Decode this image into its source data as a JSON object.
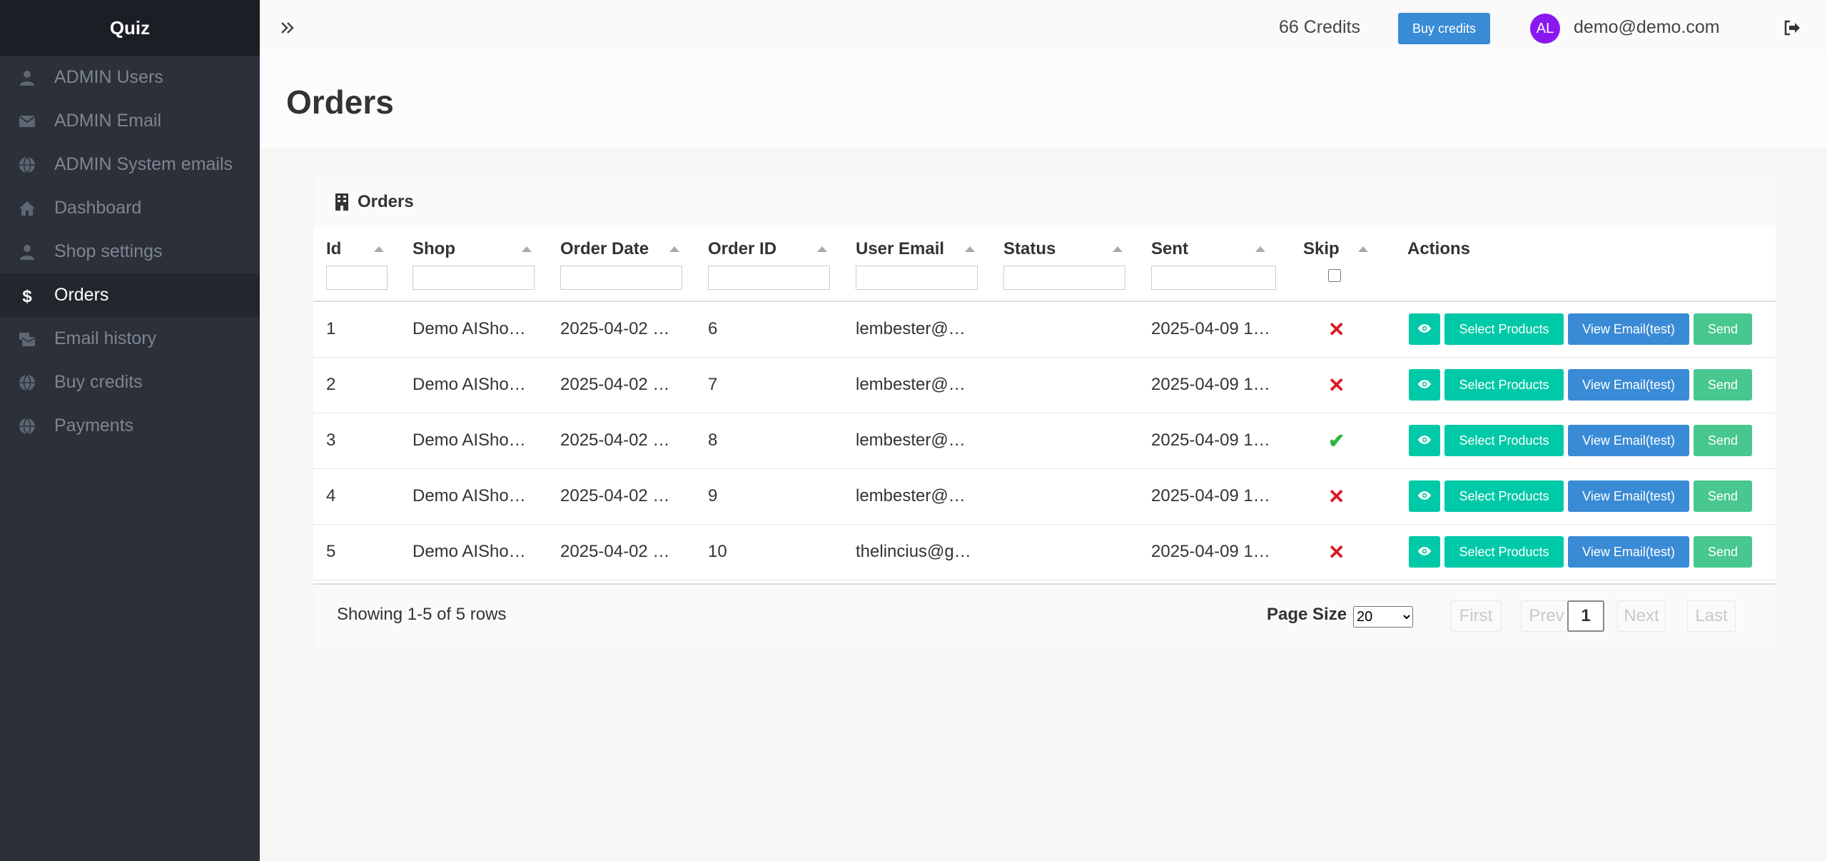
{
  "sidebar": {
    "brand": "Quiz",
    "items": [
      {
        "label": "ADMIN Users",
        "icon": "user-icon"
      },
      {
        "label": "ADMIN Email",
        "icon": "envelope-icon"
      },
      {
        "label": "ADMIN System emails",
        "icon": "globe-icon"
      },
      {
        "label": "Dashboard",
        "icon": "home-icon"
      },
      {
        "label": "Shop settings",
        "icon": "user-icon"
      },
      {
        "label": "Orders",
        "icon": "dollar-icon",
        "active": true
      },
      {
        "label": "Email history",
        "icon": "mail-bulk-icon"
      },
      {
        "label": "Buy credits",
        "icon": "globe-icon"
      },
      {
        "label": "Payments",
        "icon": "globe-icon"
      }
    ]
  },
  "topbar": {
    "credits": "66 Credits",
    "buy_label": "Buy credits",
    "avatar_initials": "AL",
    "user_email": "demo@demo.com"
  },
  "page": {
    "title": "Orders"
  },
  "card": {
    "title": "Orders",
    "columns": [
      "Id",
      "Shop",
      "Order Date",
      "Order ID",
      "User Email",
      "Status",
      "Sent",
      "Skip",
      "Actions"
    ],
    "rows": [
      {
        "id": "1",
        "shop": "Demo AISho…",
        "order_date": "2025-04-02 …",
        "order_id": "6",
        "user_email": "lembester@…",
        "status": "",
        "sent": "2025-04-09 1…",
        "skip": "✕"
      },
      {
        "id": "2",
        "shop": "Demo AISho…",
        "order_date": "2025-04-02 …",
        "order_id": "7",
        "user_email": "lembester@…",
        "status": "",
        "sent": "2025-04-09 1…",
        "skip": "✕"
      },
      {
        "id": "3",
        "shop": "Demo AISho…",
        "order_date": "2025-04-02 …",
        "order_id": "8",
        "user_email": "lembester@…",
        "status": "",
        "sent": "2025-04-09 1…",
        "skip": "✔"
      },
      {
        "id": "4",
        "shop": "Demo AISho…",
        "order_date": "2025-04-02 …",
        "order_id": "9",
        "user_email": "lembester@…",
        "status": "",
        "sent": "2025-04-09 1…",
        "skip": "✕"
      },
      {
        "id": "5",
        "shop": "Demo AISho…",
        "order_date": "2025-04-02 …",
        "order_id": "10",
        "user_email": "thelincius@g…",
        "status": "",
        "sent": "2025-04-09 1…",
        "skip": "✕"
      }
    ],
    "actions": {
      "select_products": "Select Products",
      "view_email": "View Email(test)",
      "send": "Send"
    }
  },
  "footer": {
    "showing": "Showing 1-5 of 5 rows",
    "page_size_label": "Page Size",
    "page_size": "20",
    "first": "First",
    "prev": "Prev",
    "current_page": "1",
    "next": "Next",
    "last": "Last"
  },
  "colors": {
    "sidebar_bg": "#2c3038",
    "primary_blue": "#3a8bd6",
    "teal": "#00c9a7",
    "green": "#48c78e",
    "avatar": "#8a17f0",
    "x_mark": "#e0141e",
    "check_mark": "#2fb344"
  }
}
